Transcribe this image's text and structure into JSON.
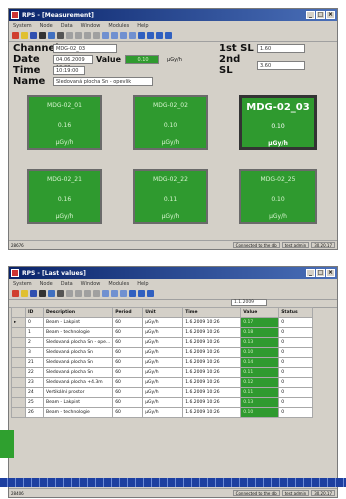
{
  "window1": {
    "title": "RPS - [Measurement]",
    "menu": [
      "System",
      "Node",
      "Data",
      "Window",
      "Modules",
      "Help"
    ],
    "fields": {
      "channel_label": "Channel",
      "channel_value": "MDG-02_03",
      "date_label": "Date",
      "date_value": "04.06.2009 10:38",
      "time_label": "Time",
      "time_value": "10:19:00",
      "name_label": "Name",
      "name_value": "Sledovaná plocha Sn - opevlik",
      "value_label": "Value",
      "value_value": "0.10",
      "value_unit": "µGy/h",
      "sl1_label": "1st SL",
      "sl1_value": "1.60",
      "sl2_label": "2nd SL",
      "sl2_value": "3.60"
    },
    "tiles": [
      {
        "name": "MDG-02_01",
        "value": "0.16",
        "unit": "µGy/h"
      },
      {
        "name": "MDG-02_02",
        "value": "0.10",
        "unit": "µGy/h"
      },
      {
        "name": "MDG-02_03",
        "value": "0.10",
        "unit": "µGy/h"
      },
      {
        "name": "MDG-02_21",
        "value": "0.16",
        "unit": "µGy/h"
      },
      {
        "name": "MDG-02_22",
        "value": "0.11",
        "unit": "µGy/h"
      },
      {
        "name": "MDG-02_25",
        "value": "0.10",
        "unit": "µGy/h"
      }
    ],
    "status": {
      "left": "28676",
      "connection": "Connected to the db",
      "user": "test admin",
      "version": "30.20.17"
    }
  },
  "window2": {
    "title": "RPS - [Last values]",
    "menu": [
      "System",
      "Node",
      "Data",
      "Window",
      "Modules",
      "Help"
    ],
    "date_filter": "1.1.2009",
    "columns": [
      "ID",
      "Description",
      "Period",
      "Unit",
      "Time",
      "Value",
      "Status"
    ],
    "rows": [
      {
        "id": "0",
        "description": "Beam - Lakpint",
        "period": "60",
        "unit": "µGy/h",
        "time": "1.6.2009 10:26",
        "value": "0.17",
        "status": "0"
      },
      {
        "id": "1",
        "description": "Beam - technologie",
        "period": "60",
        "unit": "µGy/h",
        "time": "1.6.2009 10:26",
        "value": "0.18",
        "status": "0"
      },
      {
        "id": "2",
        "description": "Sledovaná plocha Sn - ope...",
        "period": "60",
        "unit": "µGy/h",
        "time": "1.6.2009 10:26",
        "value": "0.13",
        "status": "0"
      },
      {
        "id": "3",
        "description": "Sledovaná plocha Sn",
        "period": "60",
        "unit": "µGy/h",
        "time": "1.6.2009 10:26",
        "value": "0.10",
        "status": "0"
      },
      {
        "id": "21",
        "description": "Sledovaná plocha Sn",
        "period": "60",
        "unit": "µGy/h",
        "time": "1.6.2009 10:26",
        "value": "0.14",
        "status": "0"
      },
      {
        "id": "22",
        "description": "Sledovaná plocha Sn",
        "period": "60",
        "unit": "µGy/h",
        "time": "1.6.2009 10:26",
        "value": "0.11",
        "status": "0"
      },
      {
        "id": "23",
        "description": "Sledovaná plocha +4.3m",
        "period": "60",
        "unit": "µGy/h",
        "time": "1.6.2009 10:26",
        "value": "0.12",
        "status": "0"
      },
      {
        "id": "24",
        "description": "Vertikální prostor",
        "period": "60",
        "unit": "µGy/h",
        "time": "1.6.2009 10:26",
        "value": "0.11",
        "status": "0"
      },
      {
        "id": "25",
        "description": "Beam - Lakpint",
        "period": "60",
        "unit": "µGy/h",
        "time": "1.6.2009 10:26",
        "value": "0.13",
        "status": "0"
      },
      {
        "id": "26",
        "description": "Beam - technologie",
        "period": "60",
        "unit": "µGy/h",
        "time": "1.6.2009 10:26",
        "value": "0.10",
        "status": "0"
      }
    ],
    "status": {
      "left": "28406",
      "connection": "Connected to the db",
      "user": "test admin",
      "version": "30.20.17"
    }
  }
}
